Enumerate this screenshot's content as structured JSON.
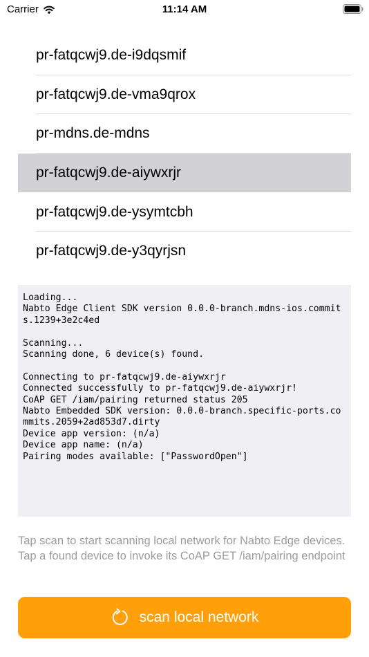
{
  "status_bar": {
    "carrier": "Carrier",
    "time": "11:14 AM"
  },
  "devices": [
    {
      "label": "pr-fatqcwj9.de-i9dqsmif",
      "selected": false
    },
    {
      "label": "pr-fatqcwj9.de-vma9qrox",
      "selected": false
    },
    {
      "label": "pr-mdns.de-mdns",
      "selected": false
    },
    {
      "label": "pr-fatqcwj9.de-aiywxrjr",
      "selected": true
    },
    {
      "label": "pr-fatqcwj9.de-ysymtcbh",
      "selected": false
    },
    {
      "label": "pr-fatqcwj9.de-y3qyrjsn",
      "selected": false
    }
  ],
  "log": {
    "text": "Loading...\nNabto Edge Client SDK version 0.0.0-branch.mdns-ios.commits.1239+3e2c4ed\n\nScanning...\nScanning done, 6 device(s) found.\n\nConnecting to pr-fatqcwj9.de-aiywxrjr\nConnected successfully to pr-fatqcwj9.de-aiywxrjr!\nCoAP GET /iam/pairing returned status 205\nNabto Embedded SDK version: 0.0.0-branch.specific-ports.commits.2059+2ad853d7.dirty\nDevice app version: (n/a)\nDevice app name: (n/a)\nPairing modes available: [\"PasswordOpen\"]"
  },
  "hint": "Tap scan to start scanning local network for Nabto Edge devices. Tap a found device to invoke its CoAP GET /iam/pairing endpoint",
  "scan_button": {
    "label": "scan local network",
    "icon": "refresh-icon"
  },
  "colors": {
    "accent": "#ff9f0a",
    "selected_row": "#d1d1d6",
    "log_background": "#efeff4",
    "hint_text": "#9b9ba1"
  }
}
